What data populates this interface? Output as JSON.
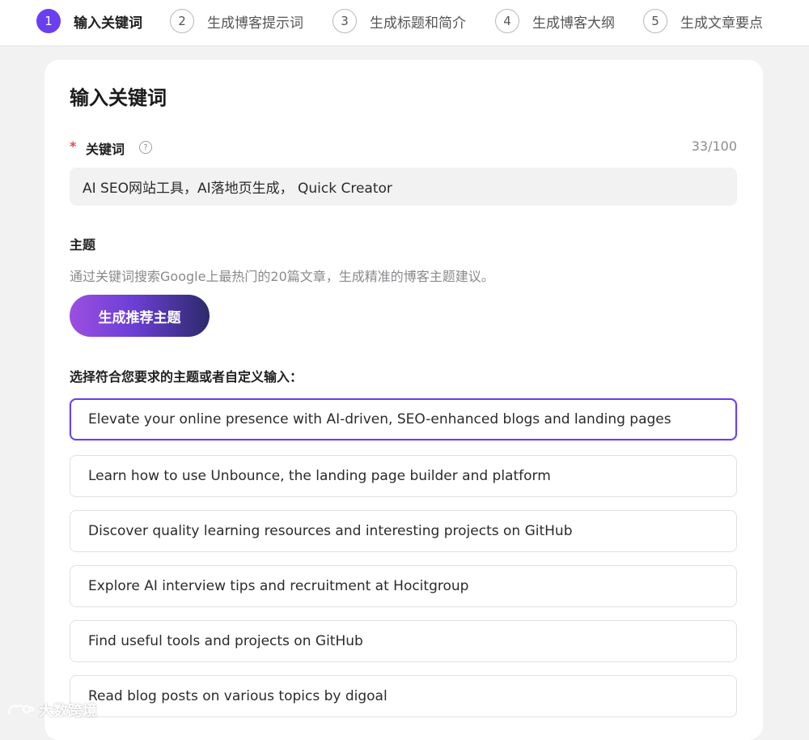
{
  "steps": [
    {
      "num": "1",
      "label": "输入关键词",
      "active": true
    },
    {
      "num": "2",
      "label": "生成博客提示词",
      "active": false
    },
    {
      "num": "3",
      "label": "生成标题和简介",
      "active": false
    },
    {
      "num": "4",
      "label": "生成博客大纲",
      "active": false
    },
    {
      "num": "5",
      "label": "生成文章要点",
      "active": false
    }
  ],
  "card": {
    "title": "输入关键词",
    "keyword": {
      "required_mark": "*",
      "label": "关键词",
      "help_icon": "question-circle-icon",
      "counter": "33/100",
      "value": "AI SEO网站工具，AI落地页生成， Quick Creator"
    },
    "topic": {
      "label": "主题",
      "hint": "通过关键词搜索Google上最热门的20篇文章，生成精准的博客主题建议。",
      "generate_button": "生成推荐主题",
      "select_label": "选择符合您要求的主题或者自定义输入：",
      "options": [
        "Elevate your online presence with AI-driven, SEO-enhanced blogs and landing pages",
        "Learn how to use Unbounce, the landing page builder and platform",
        "Discover quality learning resources and interesting projects on GitHub",
        "Explore AI interview tips and recruitment at Hocitgroup",
        "Find useful tools and projects on GitHub",
        "Read blog posts on various topics by digoal"
      ],
      "selected_index": 0
    }
  },
  "watermark": {
    "text": "大数跨境",
    "logo_icon": "watermark-logo-icon"
  },
  "colors": {
    "accent": "#6a3ff0",
    "required": "#e5484d",
    "button_gradient_start": "#9b4fe0",
    "button_gradient_end": "#2c2a6b"
  }
}
